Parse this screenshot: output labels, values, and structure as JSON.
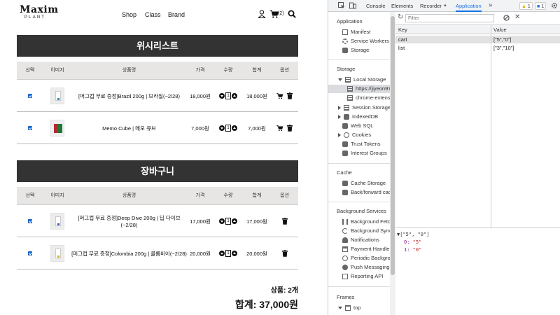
{
  "shop": {
    "logo": {
      "main": "Maxim",
      "sub": "PLANT"
    },
    "nav": [
      "Shop",
      "Class",
      "Brand"
    ],
    "cart_count": "(2)",
    "wishlist": {
      "title": "위시리스트",
      "headers": [
        "선택",
        "이미지",
        "상품명",
        "가격",
        "수량",
        "합계",
        "옵션"
      ],
      "rows": [
        {
          "name": "[머그컵 무료 증정]Brazil 200g | 브라질(~2/28)",
          "price": "18,000원",
          "qty": "1",
          "total": "18,000원",
          "thumb": "coffee-pack"
        },
        {
          "name": "Memo Cube | 메모 큐브",
          "price": "7,000원",
          "qty": "1",
          "total": "7,000원",
          "thumb": "memo-cube"
        }
      ]
    },
    "cart": {
      "title": "장바구니",
      "headers": [
        "선택",
        "이미지",
        "상품명",
        "가격",
        "수량",
        "합계",
        "옵션"
      ],
      "rows": [
        {
          "name": "[머그컵 무료 증정]Deep Dive 200g | 딥 다이브(~2/28)",
          "price": "17,000원",
          "qty": "1",
          "total": "17,000원",
          "thumb": "coffee-pack"
        },
        {
          "name": "[머그컵 무료 증정]Colombia 200g | 콜롬비아(~2/28)",
          "price": "20,000원",
          "qty": "1",
          "total": "20,000원",
          "thumb": "coffee-pack"
        }
      ]
    },
    "summary": {
      "count": "상품: 2개",
      "total": "합계: 37,000원"
    }
  },
  "devtools": {
    "tabs": [
      "Console",
      "Elements",
      "Recorder",
      "Application"
    ],
    "active_tab": "Application",
    "badges": {
      "warn": "1",
      "info": "1"
    },
    "filter_placeholder": "Filter",
    "sidebar": {
      "application": {
        "title": "Application",
        "items": [
          "Manifest",
          "Service Workers",
          "Storage"
        ]
      },
      "storage": {
        "title": "Storage",
        "items": [
          "Local Storage",
          "https://jiyeon97",
          "chrome-extensio",
          "Session Storage",
          "IndexedDB",
          "Web SQL",
          "Cookies",
          "Trust Tokens",
          "Interest Groups"
        ]
      },
      "cache": {
        "title": "Cache",
        "items": [
          "Cache Storage",
          "Back/forward cach"
        ]
      },
      "background": {
        "title": "Background Services",
        "items": [
          "Background Fetch",
          "Background Sync",
          "Notifications",
          "Payment Handler",
          "Periodic Backgrou",
          "Push Messaging",
          "Reporting API"
        ]
      },
      "frames": {
        "title": "Frames",
        "items": [
          "top"
        ]
      }
    },
    "table": {
      "headers": [
        "Key",
        "Value"
      ],
      "rows": [
        {
          "key": "cart",
          "value": "[\"5\",\"0\"]"
        },
        {
          "key": "list",
          "value": "[\"3\",\"10\"]"
        }
      ]
    },
    "preview": {
      "line0": "▼[\"5\", \"0\"]",
      "items": [
        {
          "key": "0:",
          "value": "\"5\""
        },
        {
          "key": "1:",
          "value": "\"0\""
        }
      ]
    }
  },
  "colors": {
    "section_bar": "#333333",
    "header_bg": "#e8e5e5",
    "devtools_accent": "#1a73e8"
  }
}
